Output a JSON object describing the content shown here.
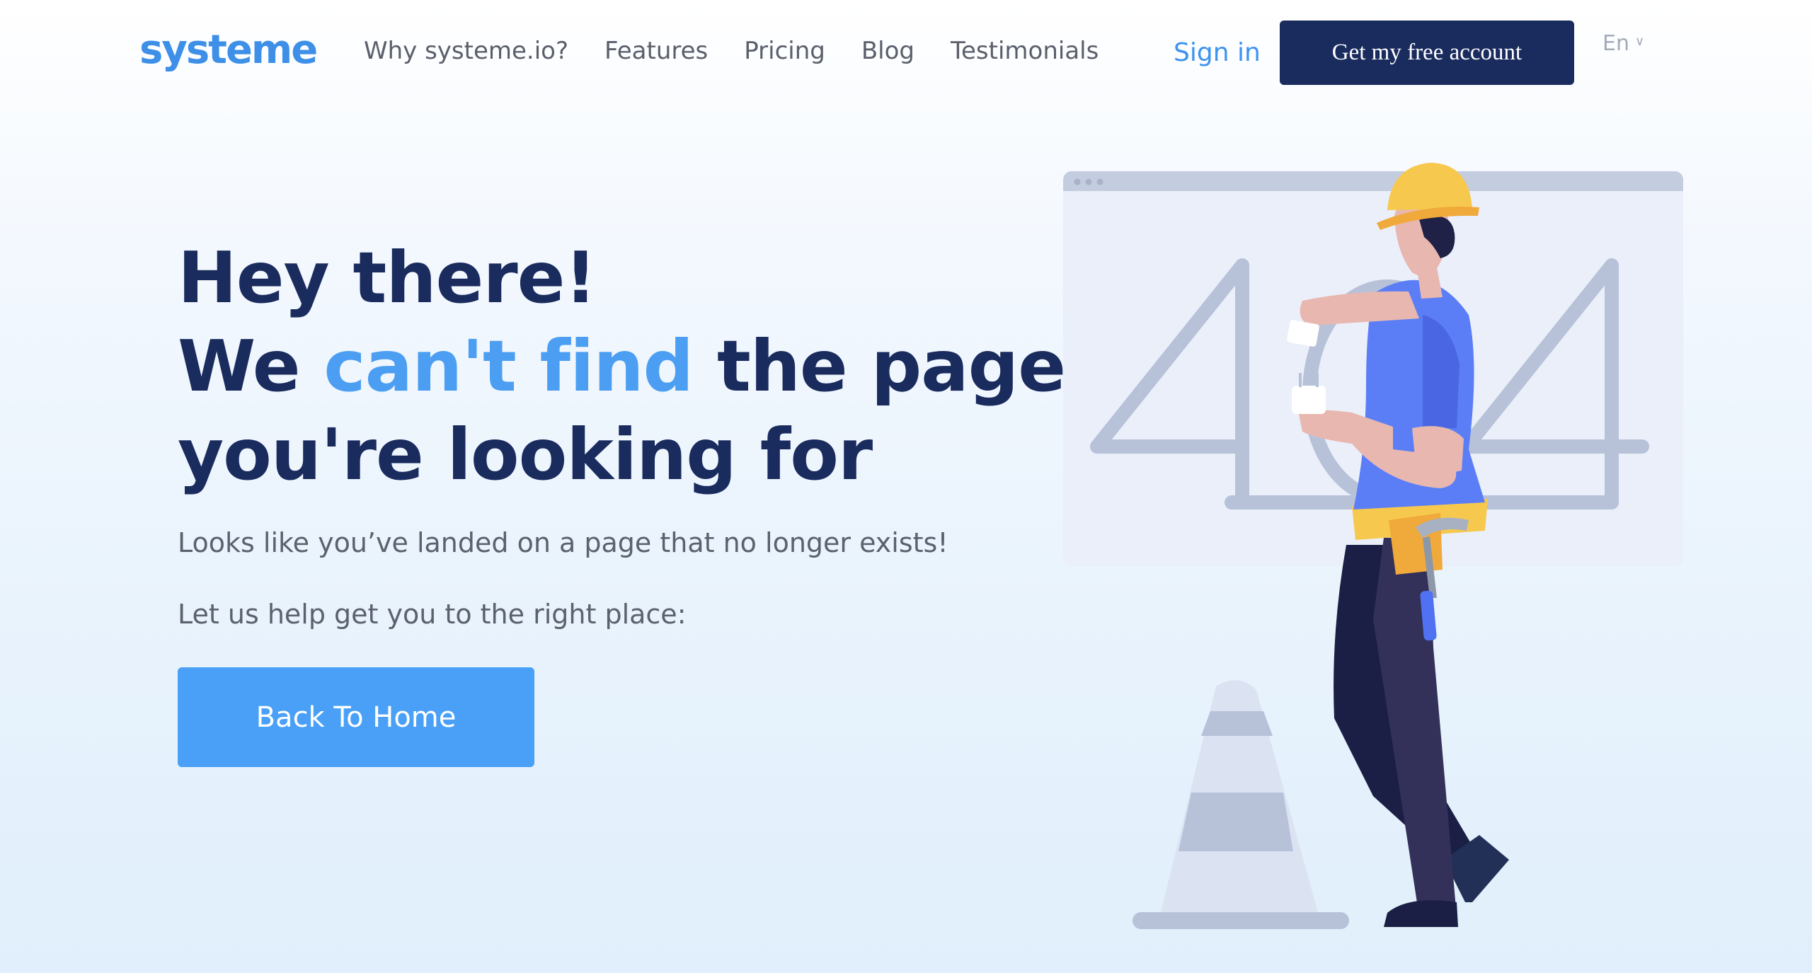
{
  "header": {
    "logo": "systeme",
    "nav": [
      "Why systeme.io?",
      "Features",
      "Pricing",
      "Blog",
      "Testimonials"
    ],
    "sign_in": "Sign in",
    "cta": "Get my free account",
    "language": "En"
  },
  "main": {
    "title_line1": "Hey there!",
    "title_line2_pre": "We ",
    "title_line2_accent": "can't find",
    "title_line2_post": " the page",
    "title_line3": "you're looking for",
    "subtitle": "Looks like you’ve landed on a page that no longer exists!",
    "help_text": "Let us help get you to the right place:",
    "back_button": "Back To Home"
  },
  "illustration": {
    "icon": "worker-404-illustration",
    "colors": {
      "accent": "#4aa0f7",
      "navy": "#1a2b5e",
      "helmet": "#f7c84e",
      "shirt": "#5b7ef7"
    }
  }
}
